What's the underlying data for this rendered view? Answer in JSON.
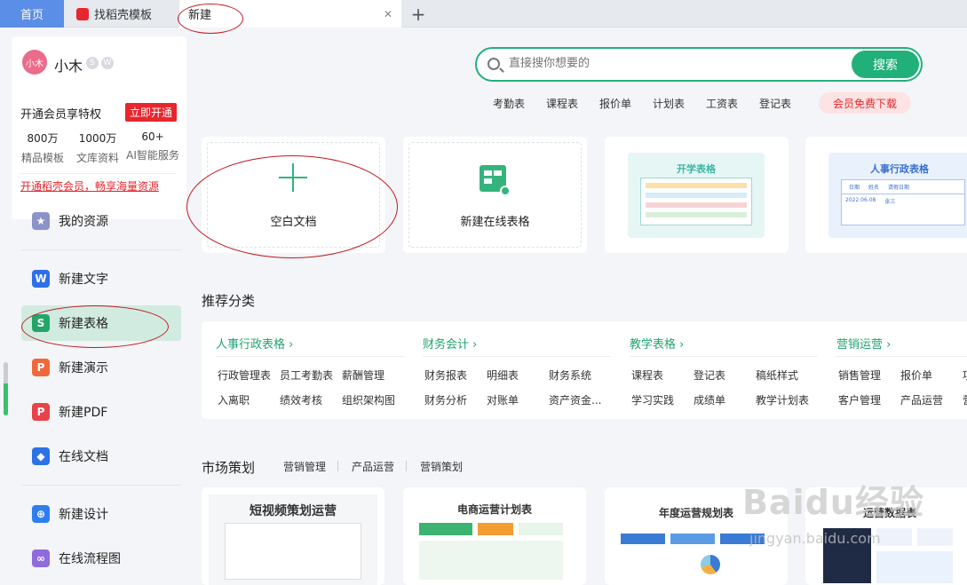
{
  "tabs": {
    "home": "首页",
    "daoke": "找稻壳模板",
    "new_tab": "新建",
    "close": "✕",
    "add": "+"
  },
  "user": {
    "avatar_text": "小木",
    "name": "小木",
    "badges": [
      "S",
      "W"
    ],
    "vip_text": "开通会员享特权",
    "vip_button": "立即开通",
    "stats": [
      {
        "value": "800万",
        "label": "精品模板"
      },
      {
        "value": "1000万",
        "label": "文库资料"
      },
      {
        "value": "60+",
        "label": "AI智能服务"
      }
    ],
    "vip_link": "开通稻壳会员，畅享海量资源"
  },
  "sidebar": {
    "my_resources": "我的资源",
    "items": [
      {
        "label": "新建文字",
        "icon": "W",
        "color": "#2d6fe8"
      },
      {
        "label": "新建表格",
        "icon": "S",
        "color": "#23a567"
      },
      {
        "label": "新建演示",
        "icon": "P",
        "color": "#f0683a"
      },
      {
        "label": "新建PDF",
        "icon": "P",
        "color": "#e8424a"
      },
      {
        "label": "在线文档",
        "icon": "◆",
        "color": "#2b72e6"
      },
      {
        "label": "新建设计",
        "icon": "⊕",
        "color": "#2f7df0"
      },
      {
        "label": "在线流程图",
        "icon": "∞",
        "color": "#8f6bdc"
      }
    ]
  },
  "search": {
    "placeholder": "直接搜你想要的",
    "button": "搜索",
    "tags": [
      "考勤表",
      "课程表",
      "报价单",
      "计划表",
      "工资表",
      "登记表"
    ],
    "vip_download": "会员免费下载"
  },
  "cards": {
    "blank": "空白文档",
    "online_sheet": "新建在线表格",
    "school_tpl": "开学表格",
    "hr_tpl": "人事行政表格",
    "hr_cols": [
      "日期",
      "姓名",
      "请假日期"
    ],
    "hr_row": [
      "2022.06.08",
      "张三"
    ]
  },
  "recommend": {
    "title": "推荐分类",
    "columns": [
      {
        "title": "人事行政表格",
        "items": [
          "行政管理表",
          "员工考勤表",
          "薪酬管理",
          "入离职",
          "绩效考核",
          "组织架构图"
        ]
      },
      {
        "title": "财务会计",
        "items": [
          "财务报表",
          "明细表",
          "财务系统",
          "财务分析",
          "对账单",
          "资产资金..."
        ]
      },
      {
        "title": "教学表格",
        "items": [
          "课程表",
          "登记表",
          "稿纸样式",
          "学习实践",
          "成绩单",
          "教学计划表"
        ]
      },
      {
        "title": "营销运营",
        "items": [
          "销售管理",
          "报价单",
          "项",
          "客户管理",
          "产品运营",
          "营"
        ]
      }
    ]
  },
  "market": {
    "title": "市场策划",
    "tabs": [
      "营销管理",
      "产品运营",
      "营销策划"
    ],
    "templates": [
      "短视频策划运营",
      "电商运营计划表",
      "年度运营规划表",
      "运营数据表"
    ]
  },
  "watermark": {
    "main": "Baidu经验",
    "sub": "jingyan.baidu.com"
  }
}
